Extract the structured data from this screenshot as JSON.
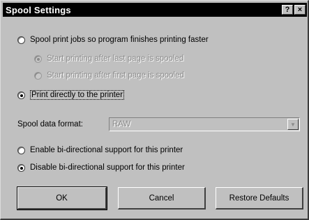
{
  "window": {
    "title": "Spool Settings",
    "help_button": "?",
    "close_button": "×"
  },
  "spool_options": {
    "spool_jobs": {
      "label": "Spool print jobs so program finishes printing faster",
      "checked": false,
      "enabled": true
    },
    "start_after_last_page": {
      "label": "Start printing after last page is spooled",
      "checked": true,
      "enabled": false
    },
    "start_after_first_page": {
      "label": "Start printing after first page is spooled",
      "checked": false,
      "enabled": false
    },
    "print_direct": {
      "label": "Print directly to the printer",
      "checked": true,
      "enabled": true
    }
  },
  "spool_format": {
    "label": "Spool data format:",
    "value": "RAW"
  },
  "bidirectional": {
    "enable": {
      "label": "Enable bi-directional support for this printer",
      "checked": false
    },
    "disable": {
      "label": "Disable bi-directional support for this printer",
      "checked": true
    }
  },
  "buttons": {
    "ok": "OK",
    "cancel": "Cancel",
    "restore": "Restore Defaults"
  }
}
